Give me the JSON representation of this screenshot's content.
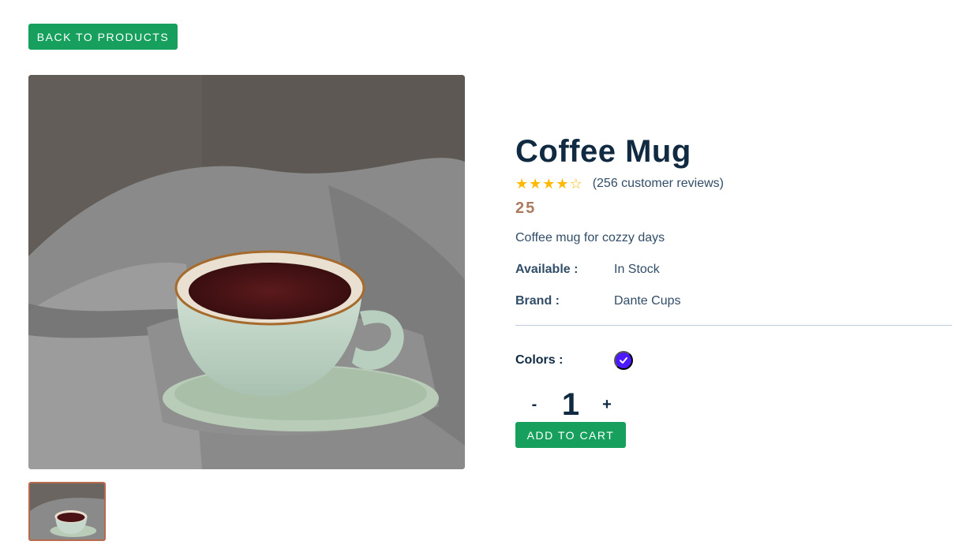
{
  "nav": {
    "back_label": "BACK TO PRODUCTS"
  },
  "product": {
    "name": "Coffee Mug",
    "rating": 3.8,
    "stars": [
      "★",
      "★",
      "★",
      "★",
      "☆"
    ],
    "reviews": "(256 customer reviews)",
    "price": "25",
    "description": "Coffee mug for cozzy days",
    "specs": [
      {
        "label": "Available :",
        "value": "In Stock"
      },
      {
        "label": "Brand :",
        "value": "Dante Cups"
      }
    ],
    "colors_label": "Colors :",
    "colors": [
      "#4d1aff"
    ],
    "quantity": {
      "decrease": "-",
      "value": "1",
      "increase": "+"
    },
    "add_to_cart": "ADD TO CART"
  },
  "images": {
    "main": "coffee-cup-on-blanket",
    "thumbnails": [
      "coffee-cup-on-blanket"
    ]
  },
  "colors": {
    "accent": "#17a05d",
    "title": "#102a42",
    "price": "#ab7a5f",
    "star": "#ffb900"
  }
}
